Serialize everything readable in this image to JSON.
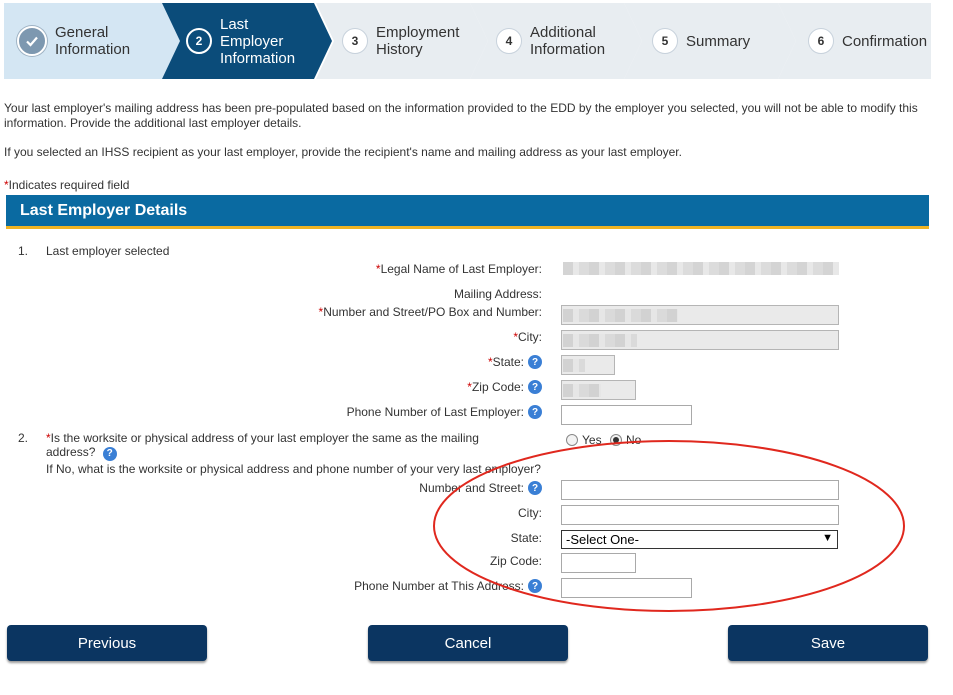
{
  "colors": {
    "brand": "#0a6aa1",
    "accent": "#f0b323",
    "button": "#0b3561",
    "step_active": "#0b4c7a",
    "step_done": "#d4e6f3",
    "step_pending": "#e8edf1",
    "annotation": "#e0281e"
  },
  "stepper": [
    {
      "num": "",
      "icon": "check-icon",
      "label": "General Information",
      "state": "done"
    },
    {
      "num": "2",
      "label": "Last Employer Information",
      "state": "active"
    },
    {
      "num": "3",
      "label": "Employment History",
      "state": "pending"
    },
    {
      "num": "4",
      "label": "Additional Information",
      "state": "pending"
    },
    {
      "num": "5",
      "label": "Summary",
      "state": "pending"
    },
    {
      "num": "6",
      "label": "Confirmation",
      "state": "pending"
    }
  ],
  "intro": {
    "p1": "Your last employer's mailing address has been pre-populated based on the information provided to the EDD by the employer you selected, you will not be able to modify this information. Provide the additional last employer details.",
    "p2": "If you selected an IHSS recipient as your last employer, provide the recipient's name and mailing address as your last employer.",
    "required_note": "Indicates required field"
  },
  "section_title": "Last Employer Details",
  "q1": {
    "num": "1.",
    "text": "Last employer selected",
    "legal_name_label": "Legal Name of Last Employer:",
    "mailing_address_label": "Mailing Address:",
    "street_label": "Number and Street/PO Box and Number:",
    "city_label": "City:",
    "state_label": "State:",
    "zip_label": "Zip Code:",
    "phone_label": "Phone Number of Last Employer:"
  },
  "q2": {
    "num": "2.",
    "text": "Is the worksite or physical address of your last employer the same as the mailing address?",
    "yes": "Yes",
    "no": "No",
    "selected": "No",
    "followup": "If No, what is the worksite or physical address and phone number of your very last employer?",
    "street_label": "Number and Street:",
    "city_label": "City:",
    "state_label": "State:",
    "state_value": "-Select One-",
    "zip_label": "Zip Code:",
    "phone_label": "Phone Number at This Address:"
  },
  "buttons": {
    "previous": "Previous",
    "cancel": "Cancel",
    "save": "Save"
  }
}
